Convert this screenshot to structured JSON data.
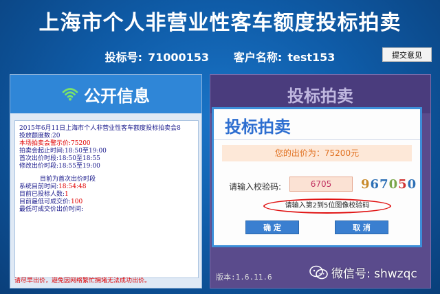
{
  "header": {
    "title": "上海市个人非营业性客车额度投标拍卖",
    "bid_number_label": "投标号:",
    "bid_number": "71000153",
    "customer_label": "客户名称:",
    "customer_name": "test153",
    "feedback_button": "提交意见"
  },
  "left_panel": {
    "title": "公开信息",
    "icon": "wifi-icon",
    "notice_lines": [
      {
        "text": "2015年6月11日上海市个人非营业性客车额度投标拍卖会8",
        "color": "#1a1a8c"
      },
      {
        "text": "投放额度数:20",
        "color": "#1a1a8c"
      },
      {
        "text": "本场拍卖会警示价:75200",
        "color": "#e00000"
      },
      {
        "text": "拍卖会起止时间:18:50至19:00",
        "color": "#1a1a8c"
      },
      {
        "text": "首次出价时段:18:50至18:55",
        "color": "#1a1a8c"
      },
      {
        "text": "修改出价时段:18:55至19:00",
        "color": "#1a1a8c"
      }
    ],
    "current_period_label": "目前为首次出价时段",
    "system_time_label": "系统目前时间:",
    "system_time": "18:54:48",
    "bidders_label": "目前已投标人数:",
    "bidders": "1",
    "lowest_price_label": "目前最低可成交价:",
    "lowest_price": "100",
    "lowest_time_label": "最低可成交价出价时间:",
    "footer_warning": "请尽早出价，避免因网络繁忙拥堵无法成功出价。"
  },
  "right_panel": {
    "title": "投标拍卖",
    "version": "版本:1.6.11.6"
  },
  "dialog": {
    "title": "投标拍卖",
    "price_text": "您的出价为：75200元",
    "captcha_label": "请输入校验码:",
    "captcha_value": "6705",
    "captcha_chars": [
      "9",
      "6",
      "7",
      "0",
      "5",
      "0"
    ],
    "hint": "请输入第2到5位图像校验码",
    "confirm_button": "确 定",
    "cancel_button": "取 消"
  },
  "watermark": {
    "text": "微信号: shwzqc",
    "icon": "wechat-icon"
  },
  "colors": {
    "background": "#0f5ca8",
    "left_header": "#2f86d7",
    "right_panel": "#5a4b8c",
    "dialog_border": "#3d8fd9",
    "warning_red": "#e00000"
  }
}
